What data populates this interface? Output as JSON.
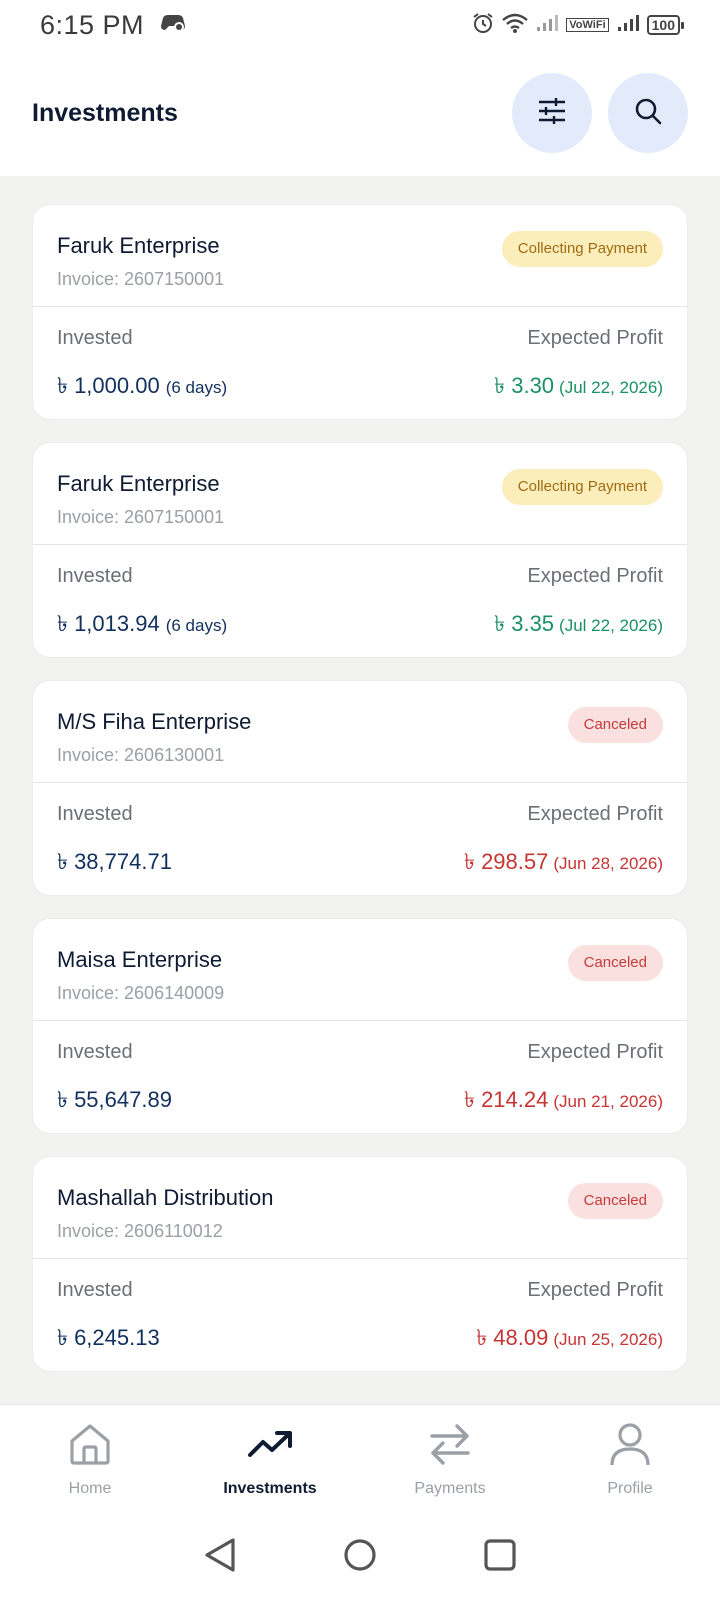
{
  "status_bar": {
    "time": "6:15 PM",
    "battery": "100",
    "vowifi": "VoWiFi"
  },
  "header": {
    "title": "Investments",
    "filter_icon": "sliders-icon",
    "search_icon": "search-icon"
  },
  "labels": {
    "invested": "Invested",
    "expected_profit": "Expected Profit"
  },
  "investments": [
    {
      "company": "Faruk Enterprise",
      "invoice": "Invoice: 2607150001",
      "status": "Collecting Payment",
      "invested_amount": "৳ 1,000.00",
      "duration": "(6 days)",
      "profit_amount": "৳ 3.30",
      "profit_date": "(Jul 22, 2026)"
    },
    {
      "company": "Faruk Enterprise",
      "invoice": "Invoice: 2607150001",
      "status": "Collecting Payment",
      "invested_amount": "৳ 1,013.94",
      "duration": "(6 days)",
      "profit_amount": "৳ 3.35",
      "profit_date": "(Jul 22, 2026)"
    },
    {
      "company": "M/S Fiha Enterprise",
      "invoice": "Invoice: 2606130001",
      "status": "Canceled",
      "invested_amount": "৳ 38,774.71",
      "duration": "",
      "profit_amount": "৳ 298.57",
      "profit_date": "(Jun 28, 2026)"
    },
    {
      "company": "Maisa Enterprise",
      "invoice": "Invoice: 2606140009",
      "status": "Canceled",
      "invested_amount": "৳ 55,647.89",
      "duration": "",
      "profit_amount": "৳ 214.24",
      "profit_date": "(Jun 21, 2026)"
    },
    {
      "company": "Mashallah Distribution",
      "invoice": "Invoice: 2606110012",
      "status": "Canceled",
      "invested_amount": "৳ 6,245.13",
      "duration": "",
      "profit_amount": "৳ 48.09",
      "profit_date": "(Jun 25, 2026)"
    }
  ],
  "bottom_nav": [
    {
      "label": "Home",
      "icon": "home-icon"
    },
    {
      "label": "Investments",
      "icon": "trending-up-icon",
      "active": true
    },
    {
      "label": "Payments",
      "icon": "swap-arrows-icon"
    },
    {
      "label": "Profile",
      "icon": "user-icon"
    }
  ],
  "colors": {
    "accent": "#0f1b33",
    "chip_bg": "#e3ebfb",
    "profit_green": "#1a9160",
    "profit_red": "#c63434",
    "collecting_bg": "#fbeeba",
    "canceled_bg": "#fbe0e0"
  }
}
